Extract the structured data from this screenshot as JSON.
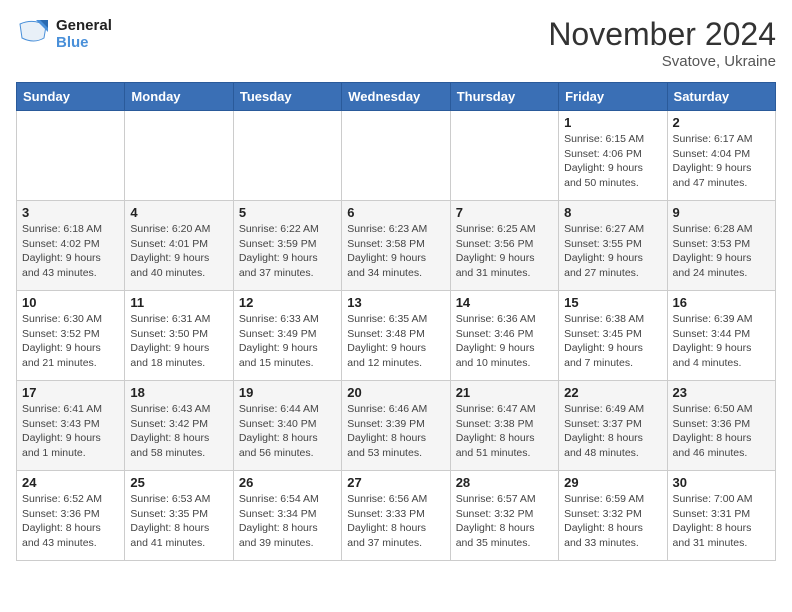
{
  "logo": {
    "text_general": "General",
    "text_blue": "Blue"
  },
  "header": {
    "month": "November 2024",
    "location": "Svatove, Ukraine"
  },
  "days_of_week": [
    "Sunday",
    "Monday",
    "Tuesday",
    "Wednesday",
    "Thursday",
    "Friday",
    "Saturday"
  ],
  "weeks": [
    [
      {
        "day": "",
        "info": ""
      },
      {
        "day": "",
        "info": ""
      },
      {
        "day": "",
        "info": ""
      },
      {
        "day": "",
        "info": ""
      },
      {
        "day": "",
        "info": ""
      },
      {
        "day": "1",
        "info": "Sunrise: 6:15 AM\nSunset: 4:06 PM\nDaylight: 9 hours\nand 50 minutes."
      },
      {
        "day": "2",
        "info": "Sunrise: 6:17 AM\nSunset: 4:04 PM\nDaylight: 9 hours\nand 47 minutes."
      }
    ],
    [
      {
        "day": "3",
        "info": "Sunrise: 6:18 AM\nSunset: 4:02 PM\nDaylight: 9 hours\nand 43 minutes."
      },
      {
        "day": "4",
        "info": "Sunrise: 6:20 AM\nSunset: 4:01 PM\nDaylight: 9 hours\nand 40 minutes."
      },
      {
        "day": "5",
        "info": "Sunrise: 6:22 AM\nSunset: 3:59 PM\nDaylight: 9 hours\nand 37 minutes."
      },
      {
        "day": "6",
        "info": "Sunrise: 6:23 AM\nSunset: 3:58 PM\nDaylight: 9 hours\nand 34 minutes."
      },
      {
        "day": "7",
        "info": "Sunrise: 6:25 AM\nSunset: 3:56 PM\nDaylight: 9 hours\nand 31 minutes."
      },
      {
        "day": "8",
        "info": "Sunrise: 6:27 AM\nSunset: 3:55 PM\nDaylight: 9 hours\nand 27 minutes."
      },
      {
        "day": "9",
        "info": "Sunrise: 6:28 AM\nSunset: 3:53 PM\nDaylight: 9 hours\nand 24 minutes."
      }
    ],
    [
      {
        "day": "10",
        "info": "Sunrise: 6:30 AM\nSunset: 3:52 PM\nDaylight: 9 hours\nand 21 minutes."
      },
      {
        "day": "11",
        "info": "Sunrise: 6:31 AM\nSunset: 3:50 PM\nDaylight: 9 hours\nand 18 minutes."
      },
      {
        "day": "12",
        "info": "Sunrise: 6:33 AM\nSunset: 3:49 PM\nDaylight: 9 hours\nand 15 minutes."
      },
      {
        "day": "13",
        "info": "Sunrise: 6:35 AM\nSunset: 3:48 PM\nDaylight: 9 hours\nand 12 minutes."
      },
      {
        "day": "14",
        "info": "Sunrise: 6:36 AM\nSunset: 3:46 PM\nDaylight: 9 hours\nand 10 minutes."
      },
      {
        "day": "15",
        "info": "Sunrise: 6:38 AM\nSunset: 3:45 PM\nDaylight: 9 hours\nand 7 minutes."
      },
      {
        "day": "16",
        "info": "Sunrise: 6:39 AM\nSunset: 3:44 PM\nDaylight: 9 hours\nand 4 minutes."
      }
    ],
    [
      {
        "day": "17",
        "info": "Sunrise: 6:41 AM\nSunset: 3:43 PM\nDaylight: 9 hours\nand 1 minute."
      },
      {
        "day": "18",
        "info": "Sunrise: 6:43 AM\nSunset: 3:42 PM\nDaylight: 8 hours\nand 58 minutes."
      },
      {
        "day": "19",
        "info": "Sunrise: 6:44 AM\nSunset: 3:40 PM\nDaylight: 8 hours\nand 56 minutes."
      },
      {
        "day": "20",
        "info": "Sunrise: 6:46 AM\nSunset: 3:39 PM\nDaylight: 8 hours\nand 53 minutes."
      },
      {
        "day": "21",
        "info": "Sunrise: 6:47 AM\nSunset: 3:38 PM\nDaylight: 8 hours\nand 51 minutes."
      },
      {
        "day": "22",
        "info": "Sunrise: 6:49 AM\nSunset: 3:37 PM\nDaylight: 8 hours\nand 48 minutes."
      },
      {
        "day": "23",
        "info": "Sunrise: 6:50 AM\nSunset: 3:36 PM\nDaylight: 8 hours\nand 46 minutes."
      }
    ],
    [
      {
        "day": "24",
        "info": "Sunrise: 6:52 AM\nSunset: 3:36 PM\nDaylight: 8 hours\nand 43 minutes."
      },
      {
        "day": "25",
        "info": "Sunrise: 6:53 AM\nSunset: 3:35 PM\nDaylight: 8 hours\nand 41 minutes."
      },
      {
        "day": "26",
        "info": "Sunrise: 6:54 AM\nSunset: 3:34 PM\nDaylight: 8 hours\nand 39 minutes."
      },
      {
        "day": "27",
        "info": "Sunrise: 6:56 AM\nSunset: 3:33 PM\nDaylight: 8 hours\nand 37 minutes."
      },
      {
        "day": "28",
        "info": "Sunrise: 6:57 AM\nSunset: 3:32 PM\nDaylight: 8 hours\nand 35 minutes."
      },
      {
        "day": "29",
        "info": "Sunrise: 6:59 AM\nSunset: 3:32 PM\nDaylight: 8 hours\nand 33 minutes."
      },
      {
        "day": "30",
        "info": "Sunrise: 7:00 AM\nSunset: 3:31 PM\nDaylight: 8 hours\nand 31 minutes."
      }
    ]
  ]
}
